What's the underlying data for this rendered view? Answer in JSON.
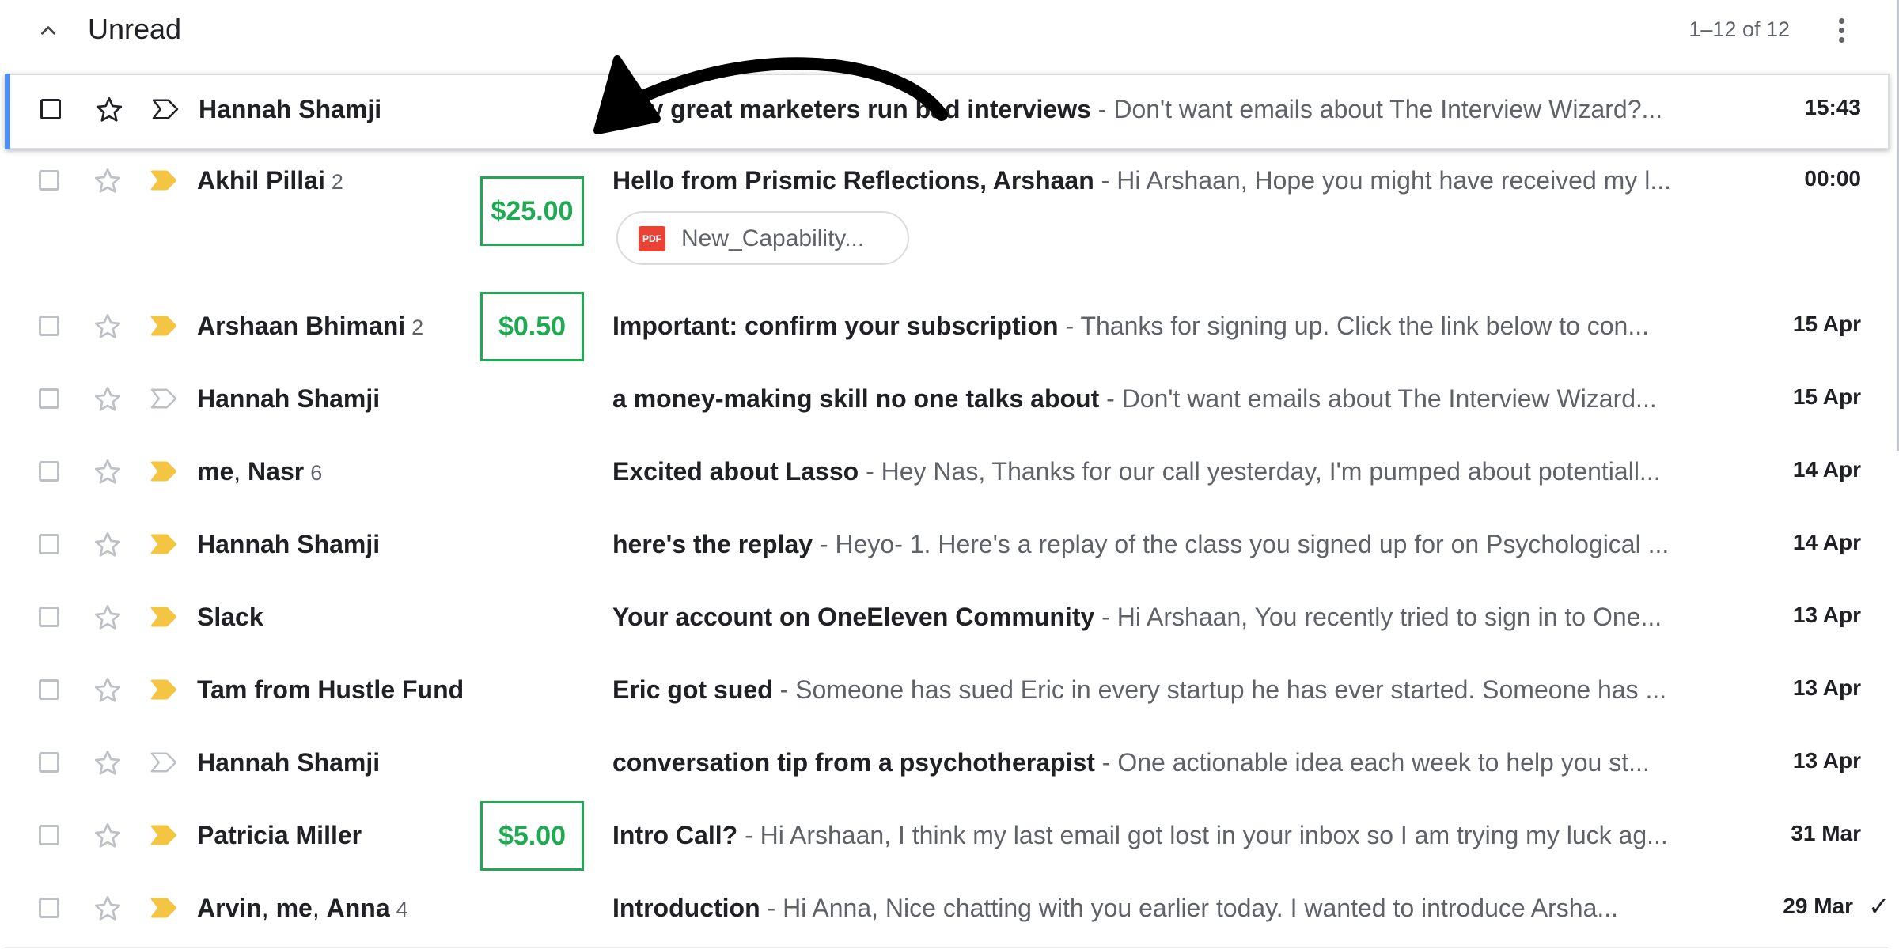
{
  "section": {
    "title": "Unread",
    "count": "1–12 of 12"
  },
  "colors": {
    "accent_focus": "#4f8ff7",
    "importance_marker": "#f4c542",
    "price_green": "#1ea952",
    "pdf_red": "#ea4335"
  },
  "rows": [
    {
      "sender": "Hannah Shamji",
      "sender_count": "",
      "subject": "why great marketers run bad interviews",
      "snippet": " - Don't want emails about The Interview Wizard?...",
      "date": "15:43",
      "important": false,
      "focused": true
    },
    {
      "sender": "Akhil Pillai",
      "sender_count": "2",
      "price": "$25.00",
      "subject": "Hello from Prismic Reflections, Arshaan",
      "snippet": " - Hi Arshaan, Hope you might have received my l...",
      "date": "00:00",
      "important": true,
      "attachment": {
        "icon": "PDF",
        "name": "New_Capability..."
      }
    },
    {
      "sender": "Arshaan Bhimani",
      "sender_count": "2",
      "price": "$0.50",
      "subject": "Important: confirm your subscription",
      "snippet": " - Thanks for signing up. Click the link below to con...",
      "date": "15 Apr",
      "important": true
    },
    {
      "sender": "Hannah Shamji",
      "sender_count": "",
      "subject": "a money-making skill no one talks about",
      "snippet": " - Don't want emails about The Interview Wizard...",
      "date": "15 Apr",
      "important": false
    },
    {
      "sender_parts": [
        "me",
        ", ",
        "Nasr"
      ],
      "sender_count": "6",
      "subject": "Excited about Lasso",
      "snippet": " - Hey Nas, Thanks for our call yesterday, I'm pumped about potentiall...",
      "date": "14 Apr",
      "important": true
    },
    {
      "sender": "Hannah Shamji",
      "sender_count": "",
      "subject": "here's the replay",
      "snippet": " - Heyo- 1. Here's a replay of the class you signed up for on Psychological ...",
      "date": "14 Apr",
      "important": true
    },
    {
      "sender": "Slack",
      "sender_count": "",
      "subject": "Your account on OneEleven Community",
      "snippet": " - Hi Arshaan, You recently tried to sign in to One...",
      "date": "13 Apr",
      "important": true
    },
    {
      "sender": "Tam from Hustle Fund",
      "sender_count": "",
      "subject": "Eric got sued",
      "snippet": " - Someone has sued Eric in every startup he has ever started. Someone has ...",
      "date": "13 Apr",
      "important": true
    },
    {
      "sender": "Hannah Shamji",
      "sender_count": "",
      "subject": "conversation tip from a psychotherapist",
      "snippet": " - One actionable idea each week to help you st...",
      "date": "13 Apr",
      "important": false
    },
    {
      "sender": "Patricia Miller",
      "sender_count": "",
      "price": "$5.00",
      "subject": "Intro Call?",
      "snippet": " - Hi Arshaan, I think my last email got lost in your inbox so I am trying my luck ag...",
      "date": "31 Mar",
      "important": true
    },
    {
      "sender_parts": [
        "Arvin",
        ", ",
        "me",
        ", ",
        "Anna"
      ],
      "sender_count": "4",
      "subject": "Introduction",
      "snippet": " - Hi Anna, Nice chatting with you earlier today. I wanted to introduce Arsha...",
      "date": "29 Mar",
      "important": true,
      "checkmark": "✓"
    }
  ]
}
